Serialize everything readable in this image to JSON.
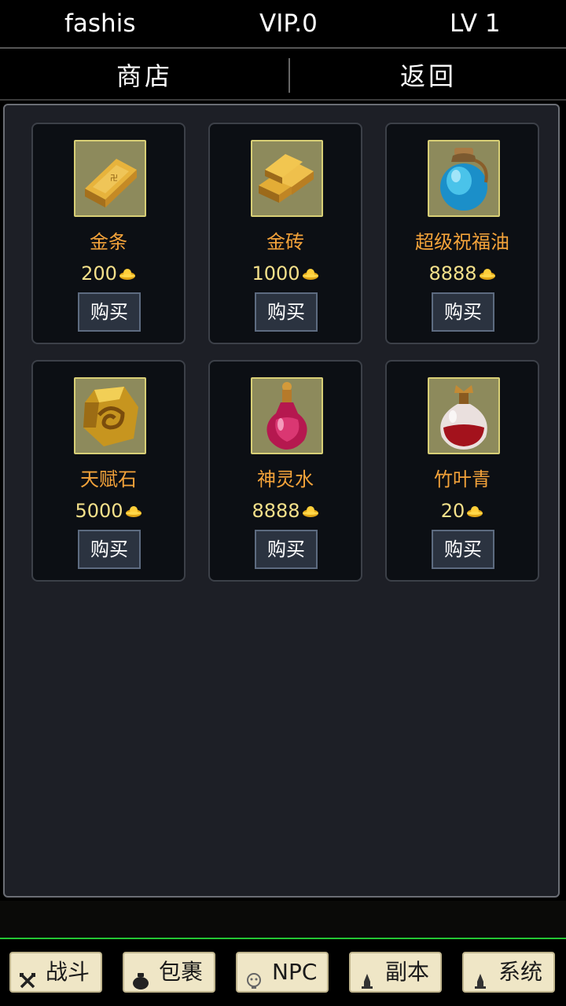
{
  "status": {
    "name": "fashis",
    "vip": "VIP.0",
    "level": "LV 1"
  },
  "nav": {
    "shop_label": "商店",
    "back_label": "返回"
  },
  "currency_icon": "gold-ingot-icon",
  "shop_items": [
    {
      "name": "金条",
      "price": "200",
      "icon": "gold-bar-icon",
      "buy_label": "购买"
    },
    {
      "name": "金砖",
      "price": "1000",
      "icon": "gold-bricks-icon",
      "buy_label": "购买"
    },
    {
      "name": "超级祝福油",
      "price": "8888",
      "icon": "blue-oil-jar-icon",
      "buy_label": "购买"
    },
    {
      "name": "天赋石",
      "price": "5000",
      "icon": "talent-stone-icon",
      "buy_label": "购买"
    },
    {
      "name": "神灵水",
      "price": "8888",
      "icon": "pink-potion-icon",
      "buy_label": "购买"
    },
    {
      "name": "竹叶青",
      "price": "20",
      "icon": "red-wine-flask-icon",
      "buy_label": "购买"
    }
  ],
  "tabs": [
    {
      "label": "战斗",
      "icon": "crossed-swords-icon"
    },
    {
      "label": "包裹",
      "icon": "bag-icon"
    },
    {
      "label": "NPC",
      "icon": "npc-face-icon"
    },
    {
      "label": "副本",
      "icon": "tower-icon"
    },
    {
      "label": "系统",
      "icon": "tower-icon"
    }
  ],
  "colors": {
    "item_name": "#f4a33a",
    "item_price": "#f4e08a",
    "panel_bg": "#1d1f26",
    "card_bg": "#0c0f14",
    "tab_bg": "#efe6c6",
    "divider_green": "#24c634"
  }
}
